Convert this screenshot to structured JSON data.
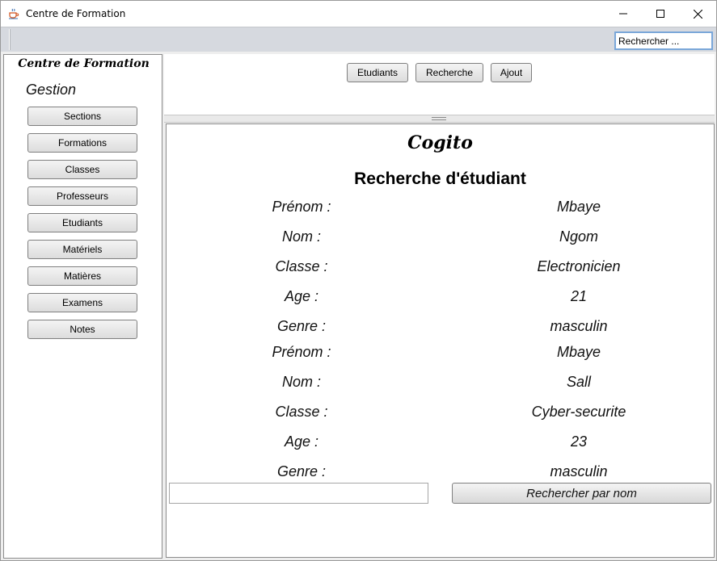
{
  "window": {
    "title": "Centre de Formation",
    "icon": "java-cup-icon",
    "controls": {
      "minimize": "minimize-icon",
      "maximize": "maximize-icon",
      "close": "close-icon"
    }
  },
  "toolbar": {
    "search_value": "Rechercher ..."
  },
  "sidebar": {
    "brand": "Centre de Formation",
    "section_title": "Gestion",
    "items": [
      {
        "label": "Sections"
      },
      {
        "label": "Formations"
      },
      {
        "label": "Classes"
      },
      {
        "label": "Professeurs"
      },
      {
        "label": "Etudiants"
      },
      {
        "label": "Matériels"
      },
      {
        "label": "Matières"
      },
      {
        "label": "Examens"
      },
      {
        "label": "Notes"
      }
    ]
  },
  "top_nav": {
    "etudiants": "Etudiants",
    "recherche": "Recherche",
    "ajout": "Ajout"
  },
  "main": {
    "logo": "Cogito",
    "heading": "Recherche d'étudiant",
    "results": [
      {
        "prenom_label": "Prénom :",
        "prenom": "Mbaye",
        "nom_label": "Nom :",
        "nom": "Ngom",
        "classe_label": "Classe :",
        "classe": "Electronicien",
        "age_label": "Age :",
        "age": "21",
        "genre_label": "Genre :",
        "genre": "masculin"
      },
      {
        "prenom_label": "Prénom :",
        "prenom": "Mbaye",
        "nom_label": "Nom :",
        "nom": "Sall",
        "classe_label": "Classe :",
        "classe": "Cyber-securite",
        "age_label": "Age :",
        "age": "23",
        "genre_label": "Genre :",
        "genre": "masculin"
      }
    ],
    "name_input_value": "",
    "search_by_name_button": "Rechercher par nom"
  }
}
